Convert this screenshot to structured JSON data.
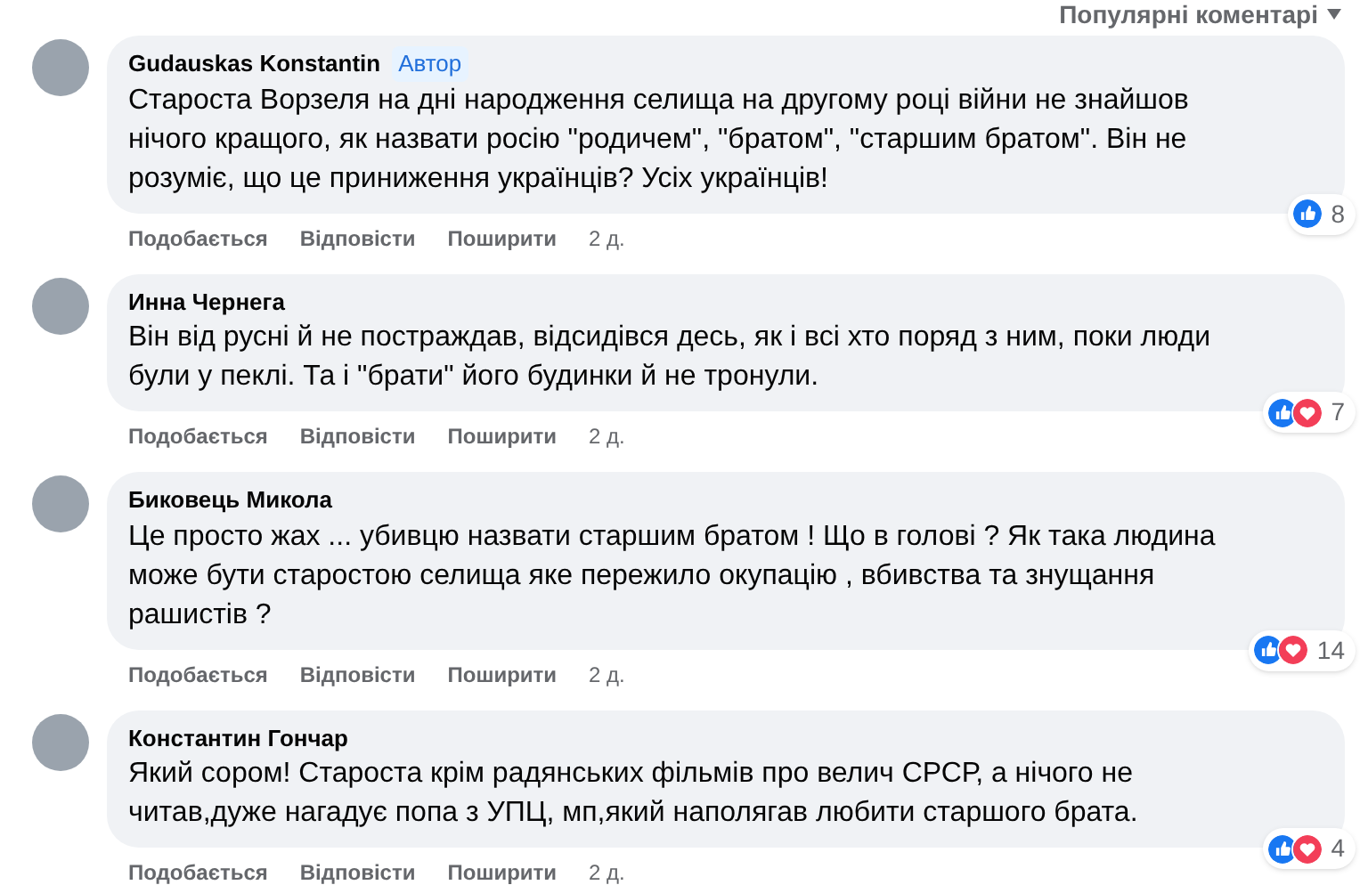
{
  "sort_menu": {
    "label": "Популярні коментарі"
  },
  "comments": [
    {
      "author": "Gudauskas Konstantin",
      "badge": "Автор",
      "text": "Староста Ворзеля на дні народження селища на другому році війни не знайшов нічого кращого, як назвати росію \"родичем\", \"братом\", \"старшим братом\". Він не розуміє, що це приниження українців? Усіх українців!",
      "actions": [
        "Подобається",
        "Відповісти",
        "Поширити"
      ],
      "time": "2 д.",
      "reactions": [
        {
          "kind": "like"
        }
      ],
      "reaction_count": "8"
    },
    {
      "author": "Инна Чернега",
      "text": "Він від русні й не постраждав, відсидівся десь, як і всі хто поряд з ним, поки люди були у пеклі. Та і \"брати\" його будинки й не тронули.",
      "actions": [
        "Подобається",
        "Відповісти",
        "Поширити"
      ],
      "time": "2 д.",
      "reactions": [
        {
          "kind": "like"
        },
        {
          "kind": "love"
        }
      ],
      "reaction_count": "7"
    },
    {
      "author": "Биковець Микола",
      "text": "Це просто жах ... убивцю назвати старшим братом ! Що в голові ? Як така людина може бути старостою селища яке пережило окупацію , вбивства та знущання рашистів ?",
      "actions": [
        "Подобається",
        "Відповісти",
        "Поширити"
      ],
      "time": "2 д.",
      "reactions": [
        {
          "kind": "like"
        },
        {
          "kind": "love"
        }
      ],
      "reaction_count": "14"
    },
    {
      "author": "Константин Гончар",
      "text": "Який сором! Староста крім радянських фільмів про велич СРСР, а нічого не читав,дуже нагадує попа з УПЦ, мп,який наполягав любити старшого брата.",
      "actions": [
        "Подобається",
        "Відповісти",
        "Поширити"
      ],
      "time": "2 д.",
      "reactions": [
        {
          "kind": "like"
        },
        {
          "kind": "love"
        }
      ],
      "reaction_count": "4"
    }
  ]
}
